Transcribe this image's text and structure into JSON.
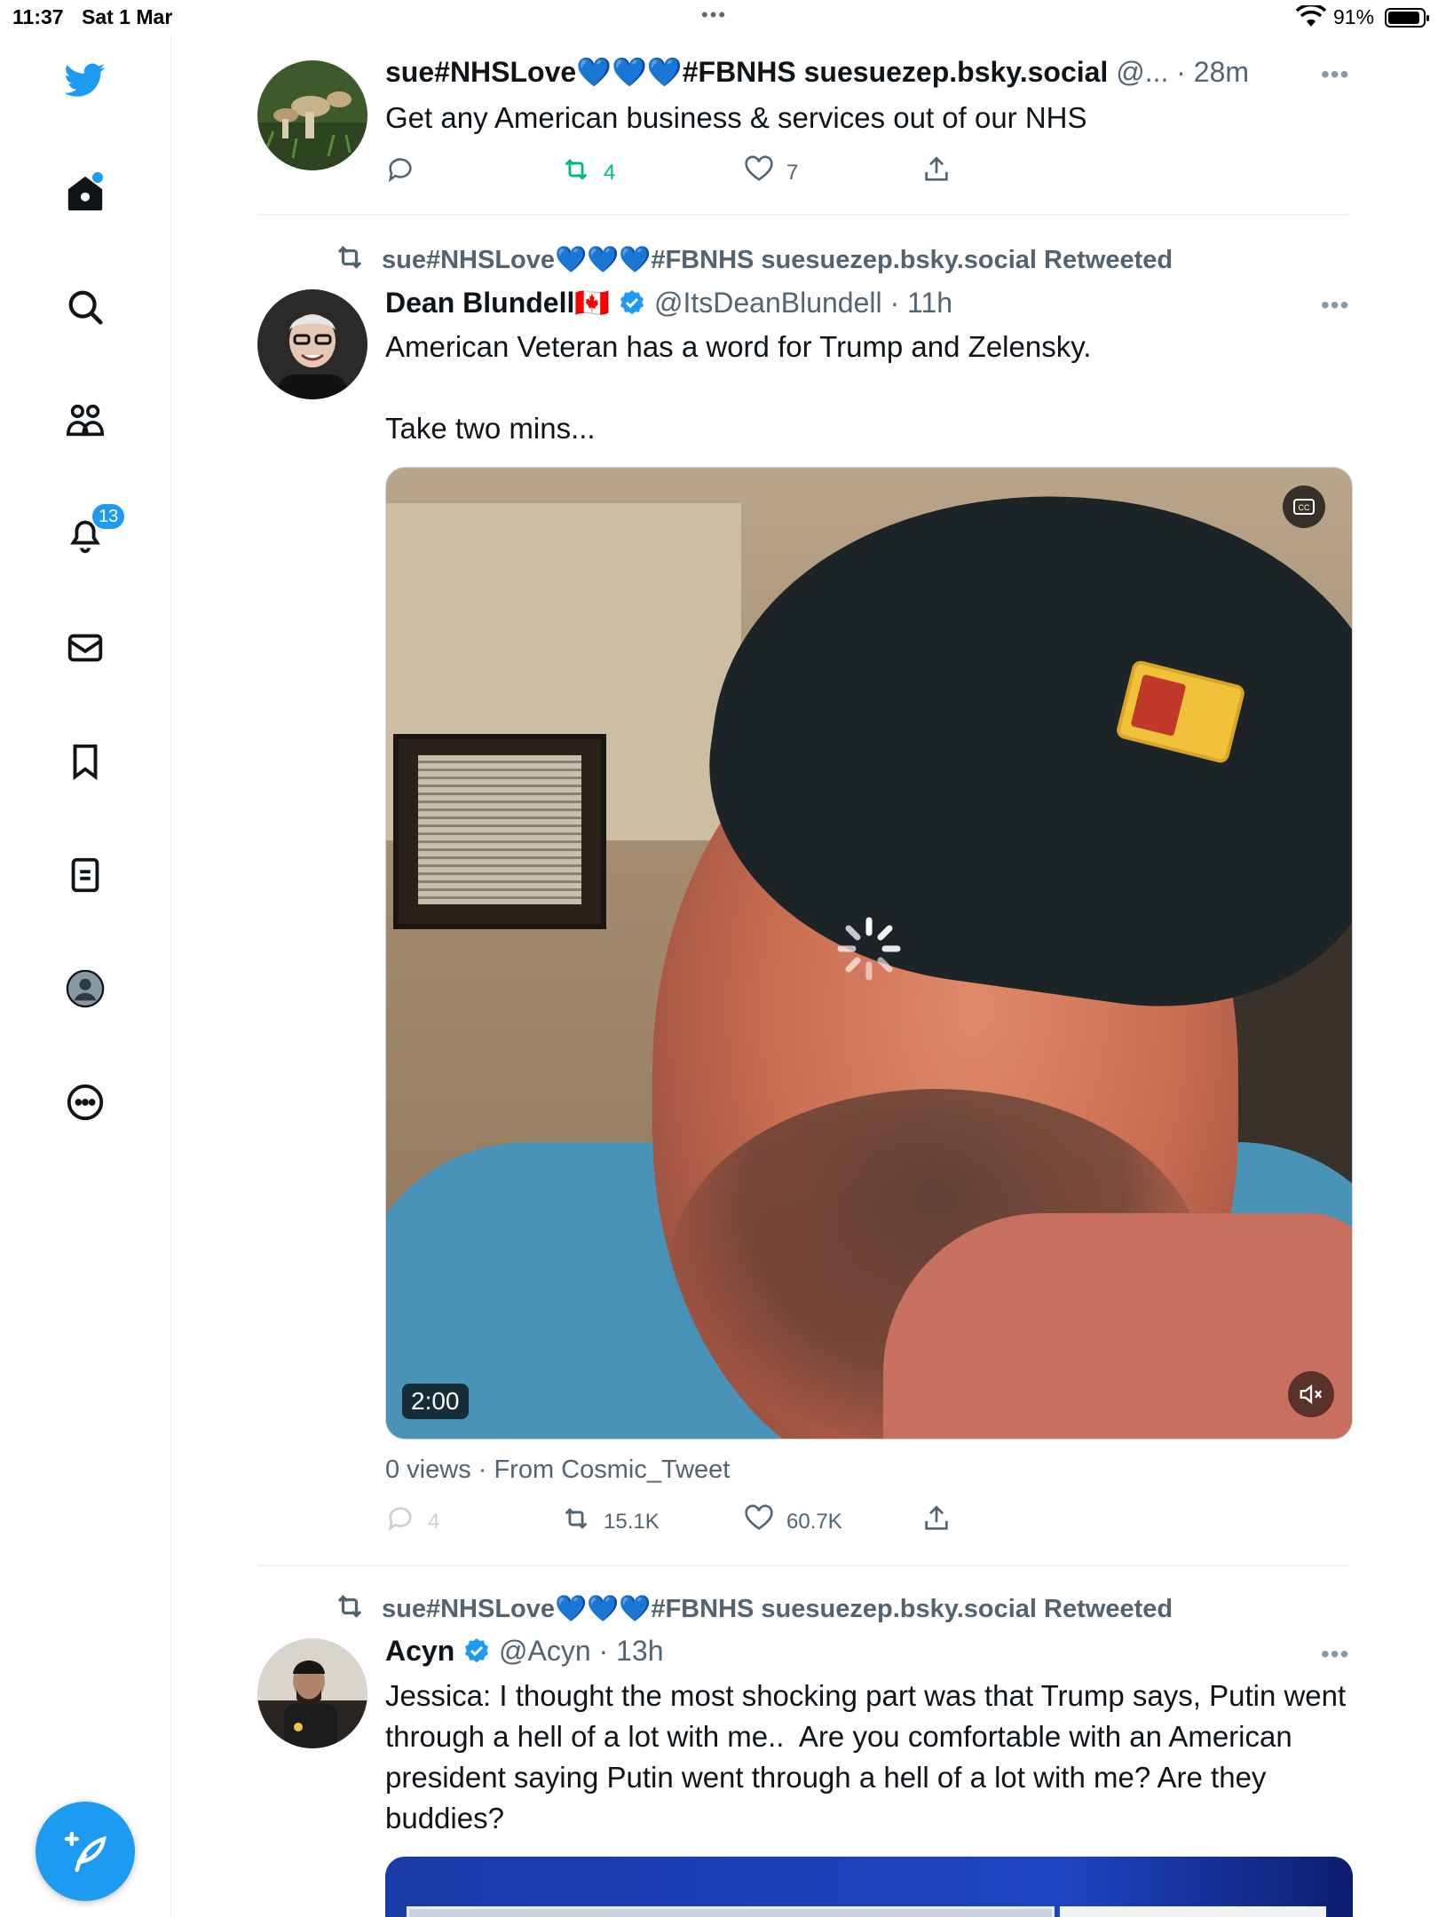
{
  "status_bar": {
    "time": "11:37",
    "date": "Sat 1 Mar",
    "battery": "91%",
    "battery_level": 0.91
  },
  "sidebar": {
    "notifications_count": "13",
    "items": [
      "home-icon",
      "search-icon",
      "communities-icon",
      "notifications-icon",
      "messages-icon",
      "bookmarks-icon",
      "lists-icon",
      "profile-icon",
      "more-icon"
    ]
  },
  "colors": {
    "accent": "#1d9bf0",
    "retweet_green": "#00ba7c",
    "muted": "#536471"
  },
  "tweets": [
    {
      "name": "sue#NHSLove💙💙💙#FBNHS suesuezep.bsky.social",
      "handle": "@...",
      "time": "· 28m",
      "text": "Get any American business & services out of our NHS",
      "replies": "",
      "retweets": "4",
      "likes": "7"
    },
    {
      "retweeted_by": "sue#NHSLove💙💙💙#FBNHS suesuezep.bsky.social Retweeted",
      "name": "Dean Blundell",
      "flag": "🇨🇦",
      "handle": "@ItsDeanBlundell",
      "time": "· 11h",
      "text": "American Veteran has a word for Trump and Zelensky.\n\nTake two mins...",
      "video_duration": "2:00",
      "views": "0 views · From Cosmic_Tweet",
      "replies": "4",
      "retweets": "15.1K",
      "likes": "60.7K"
    },
    {
      "retweeted_by": "sue#NHSLove💙💙💙#FBNHS suesuezep.bsky.social Retweeted",
      "name": "Acyn",
      "handle": "@Acyn",
      "time": "· 13h",
      "text": "Jessica: I thought the most shocking part was that Trump says, Putin went through a hell of a lot with me..  Are you comfortable with an American president saying Putin went through a hell of a lot with me? Are they buddies?"
    }
  ]
}
